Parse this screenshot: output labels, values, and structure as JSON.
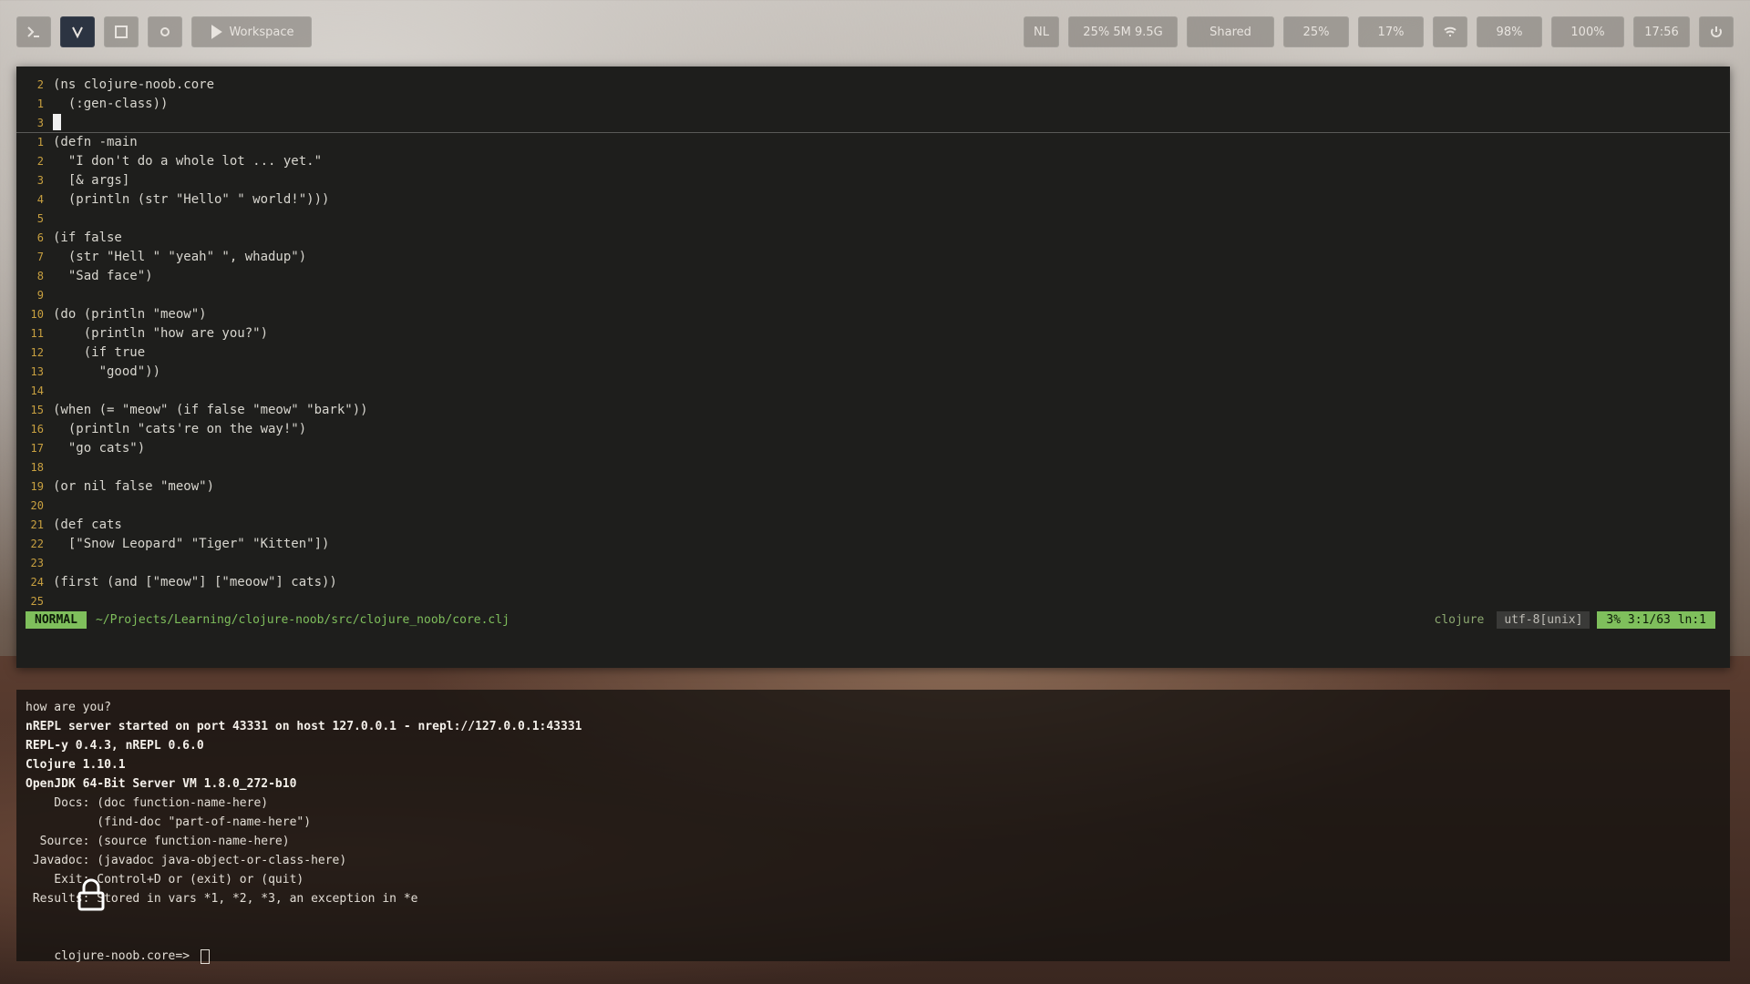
{
  "toolbar": {
    "left": [
      {
        "name": "terminal-icon",
        "label": ""
      },
      {
        "name": "vim-icon",
        "label": ""
      },
      {
        "name": "grid-icon",
        "label": ""
      },
      {
        "name": "settings-icon",
        "label": ""
      },
      {
        "name": "play-icon",
        "label": "Workspace"
      }
    ],
    "right": [
      {
        "name": "network-icon",
        "label": "NL"
      },
      {
        "name": "memory-icon",
        "label": "25% 5M 9.5G"
      },
      {
        "name": "volume-icon",
        "label": "Shared"
      },
      {
        "name": "cpu-icon",
        "label": "25%"
      },
      {
        "name": "disk-icon",
        "label": "17%"
      },
      {
        "name": "wifi-icon",
        "label": ""
      },
      {
        "name": "battery-icon",
        "label": "98%"
      },
      {
        "name": "brightness-icon",
        "label": "100%"
      },
      {
        "name": "clock-icon",
        "label": "17:56"
      },
      {
        "name": "power-icon",
        "label": ""
      }
    ]
  },
  "editor": {
    "lines": [
      {
        "n": "2",
        "text": "(ns clojure-noob.core"
      },
      {
        "n": "1",
        "text": "  (:gen-class))"
      },
      {
        "n": "3",
        "text": ""
      },
      {
        "n": "1",
        "text": "(defn -main"
      },
      {
        "n": "2",
        "text": "  \"I don't do a whole lot ... yet.\""
      },
      {
        "n": "3",
        "text": "  [& args]"
      },
      {
        "n": "4",
        "text": "  (println (str \"Hello\" \" world!\")))"
      },
      {
        "n": "5",
        "text": ""
      },
      {
        "n": "6",
        "text": "(if false"
      },
      {
        "n": "7",
        "text": "  (str \"Hell \" \"yeah\" \", whadup\")"
      },
      {
        "n": "8",
        "text": "  \"Sad face\")"
      },
      {
        "n": "9",
        "text": ""
      },
      {
        "n": "10",
        "text": "(do (println \"meow\")"
      },
      {
        "n": "11",
        "text": "    (println \"how are you?\")"
      },
      {
        "n": "12",
        "text": "    (if true"
      },
      {
        "n": "13",
        "text": "      \"good\"))"
      },
      {
        "n": "14",
        "text": ""
      },
      {
        "n": "15",
        "text": "(when (= \"meow\" (if false \"meow\" \"bark\"))"
      },
      {
        "n": "16",
        "text": "  (println \"cats're on the way!\")"
      },
      {
        "n": "17",
        "text": "  \"go cats\")"
      },
      {
        "n": "18",
        "text": ""
      },
      {
        "n": "19",
        "text": "(or nil false \"meow\")"
      },
      {
        "n": "20",
        "text": ""
      },
      {
        "n": "21",
        "text": "(def cats"
      },
      {
        "n": "22",
        "text": "  [\"Snow Leopard\" \"Tiger\" \"Kitten\"])"
      },
      {
        "n": "23",
        "text": ""
      },
      {
        "n": "24",
        "text": "(first (and [\"meow\"] [\"meoow\"] cats))"
      },
      {
        "n": "25",
        "text": ""
      }
    ],
    "status": {
      "mode": "NORMAL",
      "path": "~/Projects/Learning/clojure-noob/src/clojure_noob/core.clj",
      "filetype": "clojure",
      "encoding": "utf-8[unix]",
      "position": "3%  3:1/63  ln:1"
    }
  },
  "terminal": {
    "lines": [
      {
        "text": "how are you?",
        "bright": false
      },
      {
        "text": "nREPL server started on port 43331 on host 127.0.0.1 - nrepl://127.0.0.1:43331",
        "bright": true
      },
      {
        "text": "REPL-y 0.4.3, nREPL 0.6.0",
        "bright": true
      },
      {
        "text": "Clojure 1.10.1",
        "bright": true
      },
      {
        "text": "OpenJDK 64-Bit Server VM 1.8.0_272-b10",
        "bright": true
      },
      {
        "text": "    Docs: (doc function-name-here)",
        "bright": false
      },
      {
        "text": "          (find-doc \"part-of-name-here\")",
        "bright": false
      },
      {
        "text": "  Source: (source function-name-here)",
        "bright": false
      },
      {
        "text": " Javadoc: (javadoc java-object-or-class-here)",
        "bright": false
      },
      {
        "text": "    Exit: Control+D or (exit) or (quit)",
        "bright": false
      },
      {
        "text": " Results: Stored in vars *1, *2, *3, an exception in *e",
        "bright": false
      }
    ],
    "prompt": "clojure-noob.core=> "
  }
}
